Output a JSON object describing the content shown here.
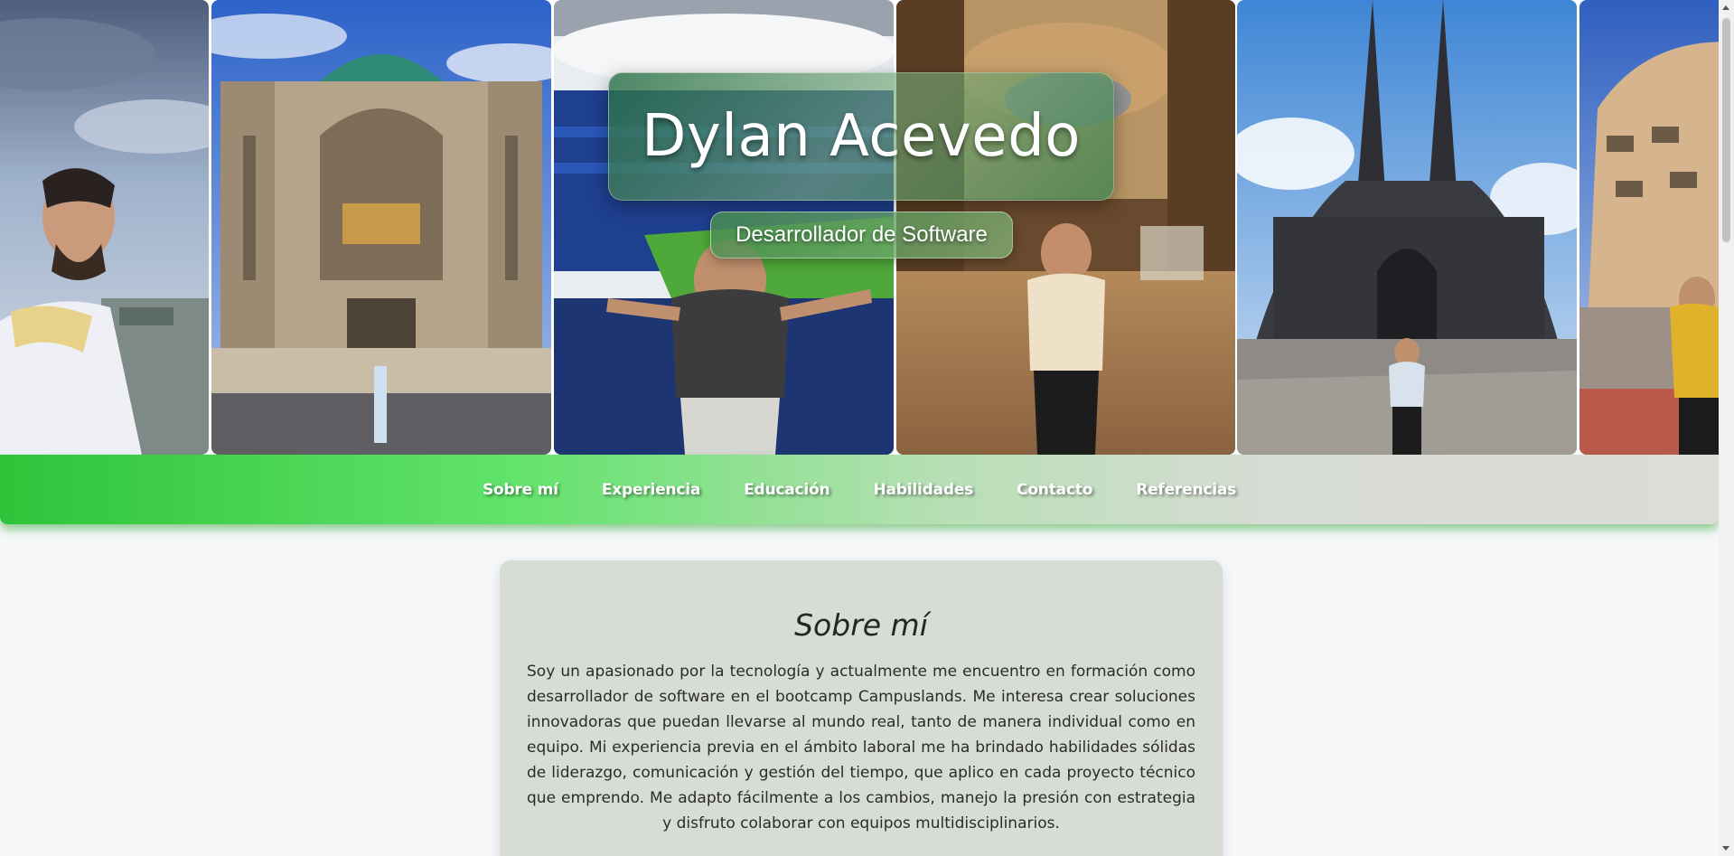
{
  "hero": {
    "name": "Dylan Acevedo",
    "role": "Desarrollador de Software",
    "photos": [
      {
        "name": "portrait-sky",
        "accent": "#8fa9c8"
      },
      {
        "name": "berlin-cathedral",
        "accent": "#4a7dcf"
      },
      {
        "name": "stadium",
        "accent": "#2f5db0"
      },
      {
        "name": "palace-gallery",
        "accent": "#a07a4e"
      },
      {
        "name": "cologne-cathedral",
        "accent": "#3b3b44"
      },
      {
        "name": "casa-mila",
        "accent": "#c9a57a"
      }
    ]
  },
  "nav": {
    "items": [
      {
        "label": "Sobre mí"
      },
      {
        "label": "Experiencia"
      },
      {
        "label": "Educación"
      },
      {
        "label": "Habilidades"
      },
      {
        "label": "Contacto"
      },
      {
        "label": "Referencias"
      }
    ]
  },
  "about": {
    "heading": "Sobre mí",
    "text": "Soy un apasionado por la tecnología y actualmente me encuentro en formación como desarrollador de software en el bootcamp Campuslands. Me interesa crear soluciones innovadoras que puedan llevarse al mundo real, tanto de manera individual como en equipo. Mi experiencia previa en el ámbito laboral me ha brindado habilidades sólidas de liderazgo, comunicación y gestión del tiempo, que aplico en cada proyecto técnico que emprendo. Me adapto fácilmente a los cambios, manejo la presión con estrategia y disfruto colaborar con equipos multidisciplinarios."
  },
  "colors": {
    "nav_green": "#2ec43a",
    "card_bg": "#d7ddd5",
    "page_bg": "#f6f7f9"
  }
}
